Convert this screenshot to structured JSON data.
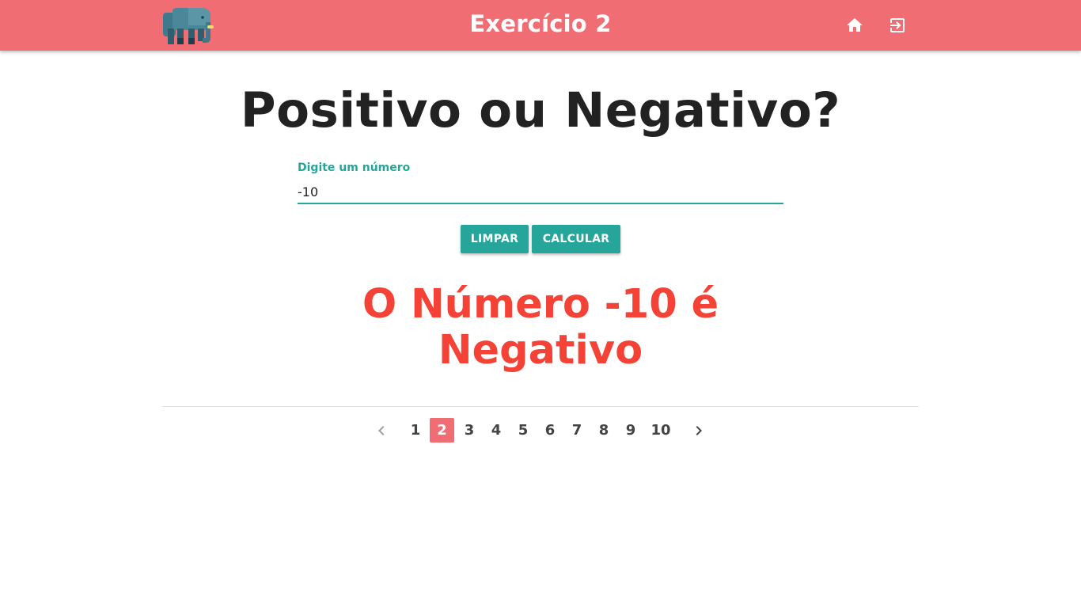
{
  "header": {
    "title": "Exercício 2",
    "logo_icon": "elephant-logo-icon",
    "home_icon": "home-icon",
    "exit_icon": "exit-icon",
    "background_color": "#f06d74"
  },
  "main": {
    "heading": "Positivo ou Negativo?",
    "input": {
      "label": "Digite um número",
      "value": "-10",
      "placeholder": ""
    },
    "buttons": {
      "clear_label": "LIMPAR",
      "calculate_label": "CALCULAR"
    },
    "result": {
      "line1": "O Número -10 é",
      "line2": "Negativo",
      "color": "#f44336"
    },
    "accent_color": "#26a69a"
  },
  "pagination": {
    "prev_icon": "chevron-left-icon",
    "next_icon": "chevron-right-icon",
    "pages": [
      "1",
      "2",
      "3",
      "4",
      "5",
      "6",
      "7",
      "8",
      "9",
      "10"
    ],
    "active_page": "2"
  }
}
